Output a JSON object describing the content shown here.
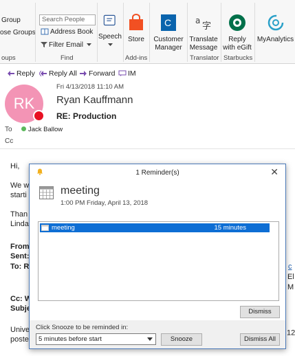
{
  "ribbon": {
    "group_btn": "Group",
    "browse_groups": "ose Groups",
    "groups_label": "oups",
    "search_people_placeholder": "Search People",
    "address_book": "Address Book",
    "filter_email": "Filter Email",
    "find_label": "Find",
    "speech": "Speech",
    "store": "Store",
    "addins_label": "Add-ins",
    "customer_manager": [
      "Customer",
      "Manager"
    ],
    "translate_message": [
      "Translate",
      "Message"
    ],
    "translator_label": "Translator",
    "reply_egift": [
      "Reply",
      "with eGift"
    ],
    "starbucks_label": "Starbucks",
    "myanalytics": "MyAnalytics"
  },
  "email": {
    "actions": {
      "reply": "Reply",
      "reply_all": "Reply All",
      "forward": "Forward",
      "im": "IM"
    },
    "date": "Fri 4/13/2018 11:10 AM",
    "avatar_initials": "RK",
    "sender": "Ryan Kauffmann",
    "subject": "RE:  Production",
    "to_label": "To",
    "to_name": "Jack Ballow",
    "cc_label": "Cc",
    "body": {
      "greeting": "Hi,",
      "line1": "We w",
      "line2": "starti",
      "line3": "Than",
      "line4": "Linda",
      "from": "From:",
      "sent": "Sent:",
      "to": "To: R",
      "cc": "Cc: W",
      "subj": "Subje",
      "univ": "Unive",
      "poste": "poste",
      "right_c": "c",
      "right_e": "El",
      "right_m": "M",
      "right_12": "12",
      "right_sup": "th"
    }
  },
  "reminder": {
    "title": "1 Reminder(s)",
    "subject": "meeting",
    "time": "1:00 PM Friday, April 13, 2018",
    "items": [
      {
        "name": "meeting",
        "due": "15 minutes"
      }
    ],
    "dismiss": "Dismiss",
    "snooze_prompt": "Click Snooze to be reminded in:",
    "snooze_value": "5 minutes before start",
    "snooze": "Snooze",
    "dismiss_all": "Dismiss All"
  },
  "colors": {
    "selection": "#0e6ed4",
    "avatar": "#f394b5",
    "presence_busy": "#e81123",
    "store_orange": "#f25022",
    "dynamics_blue": "#0a64ad",
    "starbucks_green": "#00704a"
  }
}
